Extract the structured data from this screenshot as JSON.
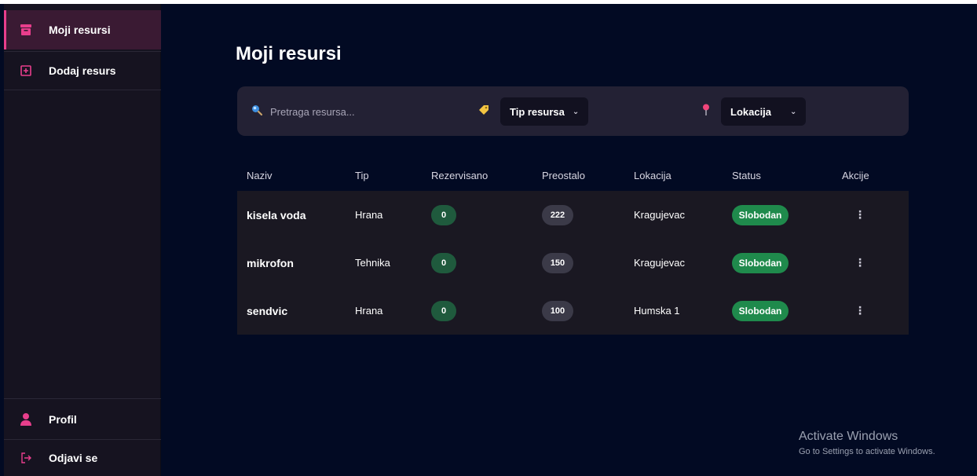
{
  "sidebar": {
    "items": [
      {
        "label": "Moji resursi",
        "icon": "archive-icon"
      },
      {
        "label": "Dodaj resurs",
        "icon": "plus-square-icon"
      }
    ],
    "profile_label": "Profil",
    "logout_label": "Odjavi se"
  },
  "main": {
    "title": "Moji resursi",
    "search": {
      "placeholder": "Pretraga resursa...",
      "value": ""
    },
    "type_filter": {
      "selected": "Tip resursa"
    },
    "location_filter": {
      "selected": "Lokacija"
    }
  },
  "table": {
    "headers": [
      "Naziv",
      "Tip",
      "Rezervisano",
      "Preostalo",
      "Lokacija",
      "Status",
      "Akcije"
    ],
    "rows": [
      {
        "naziv": "kisela voda",
        "tip": "Hrana",
        "rezervisano": "0",
        "preostalo": "222",
        "lokacija": "Kragujevac",
        "status": "Slobodan",
        "akcije": "⋮"
      },
      {
        "naziv": "mikrofon",
        "tip": "Tehnika",
        "rezervisano": "0",
        "preostalo": "150",
        "lokacija": "Kragujevac",
        "status": "Slobodan",
        "akcije": "⋮"
      },
      {
        "naziv": "sendvic",
        "tip": "Hrana",
        "rezervisano": "0",
        "preostalo": "100",
        "lokacija": "Humska 1",
        "status": "Slobodan",
        "akcije": "⋮"
      }
    ]
  },
  "watermark": {
    "title": "Activate Windows",
    "subtitle": "Go to Settings to activate Windows."
  },
  "colors": {
    "accent": "#e83e8c",
    "background": "#020a23",
    "sidebar": "#161320",
    "status_free": "#1f8a4c"
  }
}
